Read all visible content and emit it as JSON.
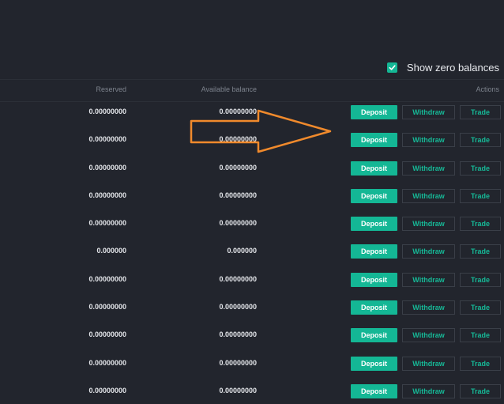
{
  "filters": {
    "show_zero_label": "Show zero balances",
    "show_zero_checked": true
  },
  "table": {
    "columns": {
      "reserved": "Reserved",
      "available": "Available balance",
      "actions": "Actions"
    },
    "rows": [
      {
        "reserved": "0.00000000",
        "available": "0.00000000"
      },
      {
        "reserved": "0.00000000",
        "available": "0.00000000"
      },
      {
        "reserved": "0.00000000",
        "available": "0.00000000"
      },
      {
        "reserved": "0.00000000",
        "available": "0.00000000"
      },
      {
        "reserved": "0.00000000",
        "available": "0.00000000"
      },
      {
        "reserved": "0.000000",
        "available": "0.000000"
      },
      {
        "reserved": "0.00000000",
        "available": "0.00000000"
      },
      {
        "reserved": "0.00000000",
        "available": "0.00000000"
      },
      {
        "reserved": "0.00000000",
        "available": "0.00000000"
      },
      {
        "reserved": "0.00000000",
        "available": "0.00000000"
      },
      {
        "reserved": "0.00000000",
        "available": "0.00000000"
      }
    ],
    "buttons": {
      "deposit": "Deposit",
      "withdraw": "Withdraw",
      "trade": "Trade"
    }
  },
  "colors": {
    "background": "#22252d",
    "accent": "#14b795",
    "annotation_arrow": "#f08a2c"
  },
  "icons": {
    "checkbox": "checkmark-icon",
    "annotation": "arrow-right-icon"
  }
}
